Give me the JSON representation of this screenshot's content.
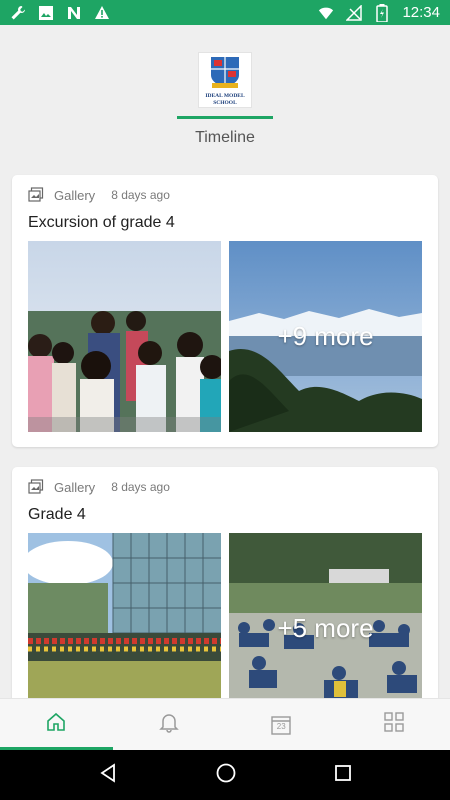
{
  "status_bar": {
    "time": "12:34",
    "left_icons": [
      "wrench-icon",
      "image-icon",
      "n-icon",
      "warning-icon"
    ],
    "right_icons": [
      "wifi-icon",
      "no-signal-icon",
      "battery-charging-icon"
    ]
  },
  "header": {
    "logo": {
      "icon": "school-crest-logo",
      "text_line1": "IDEAL MODEL",
      "text_line2": "SCHOOL"
    },
    "tab_title": "Timeline"
  },
  "cards": [
    {
      "category": "Gallery",
      "time": "8 days ago",
      "title": "Excursion of grade 4",
      "more_label": "+9 more"
    },
    {
      "category": "Gallery",
      "time": "8 days ago",
      "title": "Grade 4",
      "more_label": "+5 more"
    }
  ],
  "bottom_nav": {
    "items": [
      {
        "icon": "home-icon",
        "active": true
      },
      {
        "icon": "bell-icon",
        "active": false
      },
      {
        "icon": "calendar-icon",
        "label": "23",
        "active": false
      },
      {
        "icon": "grid-icon",
        "active": false
      }
    ]
  },
  "system_nav": [
    "back-icon",
    "home-circle-icon",
    "recents-icon"
  ],
  "colors": {
    "accent": "#1ea564",
    "background": "#efefef",
    "card": "#ffffff"
  }
}
